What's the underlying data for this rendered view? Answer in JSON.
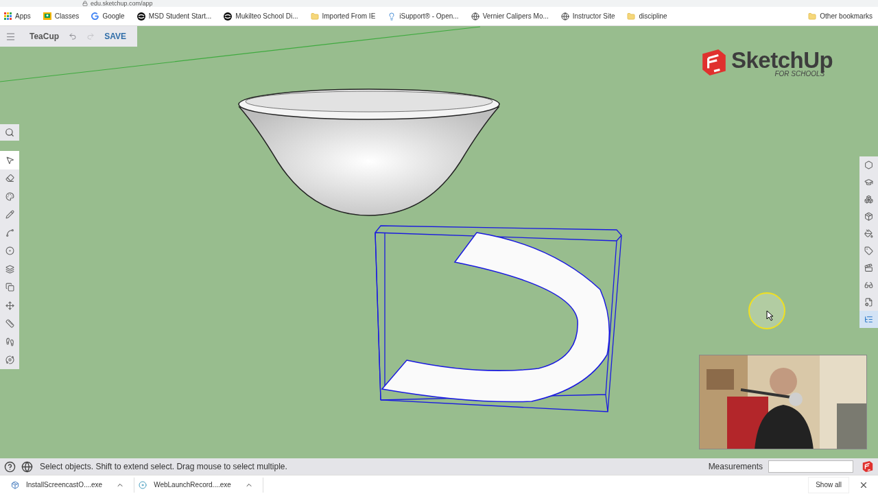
{
  "browser": {
    "url": "edu.sketchup.com/app"
  },
  "bookmarks": [
    {
      "label": "Apps",
      "kind": "apps"
    },
    {
      "label": "Classes",
      "kind": "classroom"
    },
    {
      "label": "Google",
      "kind": "google"
    },
    {
      "label": "MSD Student Start...",
      "kind": "swirl"
    },
    {
      "label": "Mukilteo School Di...",
      "kind": "swirl"
    },
    {
      "label": "Imported From IE",
      "kind": "folder"
    },
    {
      "label": "iSupport® - Open...",
      "kind": "bulb"
    },
    {
      "label": "Vernier Calipers Mo...",
      "kind": "globe"
    },
    {
      "label": "Instructor Site",
      "kind": "globe"
    },
    {
      "label": "discipline",
      "kind": "folder"
    }
  ],
  "other_bookmarks": "Other bookmarks",
  "header": {
    "title": "TeaCup",
    "save": "SAVE",
    "undo_disabled": false,
    "redo_disabled": true
  },
  "logo": {
    "name": "SketchUp",
    "tagline": "FOR SCHOOLS"
  },
  "left_tools": [
    {
      "kind": "select",
      "selected": true
    },
    {
      "kind": "eraser",
      "selected": false
    },
    {
      "kind": "paint",
      "selected": false
    },
    {
      "kind": "pencil",
      "selected": false
    },
    {
      "kind": "arc",
      "selected": false
    },
    {
      "kind": "circle",
      "selected": false
    },
    {
      "kind": "pushpull",
      "selected": false
    },
    {
      "kind": "offset",
      "selected": false
    },
    {
      "kind": "move",
      "selected": false
    },
    {
      "kind": "tape",
      "selected": false
    },
    {
      "kind": "walk",
      "selected": false
    },
    {
      "kind": "orbit",
      "selected": false
    }
  ],
  "right_panels": [
    {
      "kind": "entity",
      "selected": false
    },
    {
      "kind": "instructor",
      "selected": false
    },
    {
      "kind": "components",
      "selected": false
    },
    {
      "kind": "materials",
      "selected": false
    },
    {
      "kind": "styles",
      "selected": false
    },
    {
      "kind": "tags",
      "selected": false
    },
    {
      "kind": "scenes",
      "selected": false
    },
    {
      "kind": "display",
      "selected": false
    },
    {
      "kind": "solid",
      "selected": false
    },
    {
      "kind": "outliner",
      "selected": true
    }
  ],
  "status_bar": {
    "message": "Select objects. Shift to extend select. Drag mouse to select multiple.",
    "measurements_label": "Measurements"
  },
  "downloads": [
    {
      "name": "InstallScreencastO....exe",
      "kind": "installer"
    },
    {
      "name": "WebLaunchRecord....exe",
      "kind": "launcher"
    }
  ],
  "show_all": "Show all"
}
